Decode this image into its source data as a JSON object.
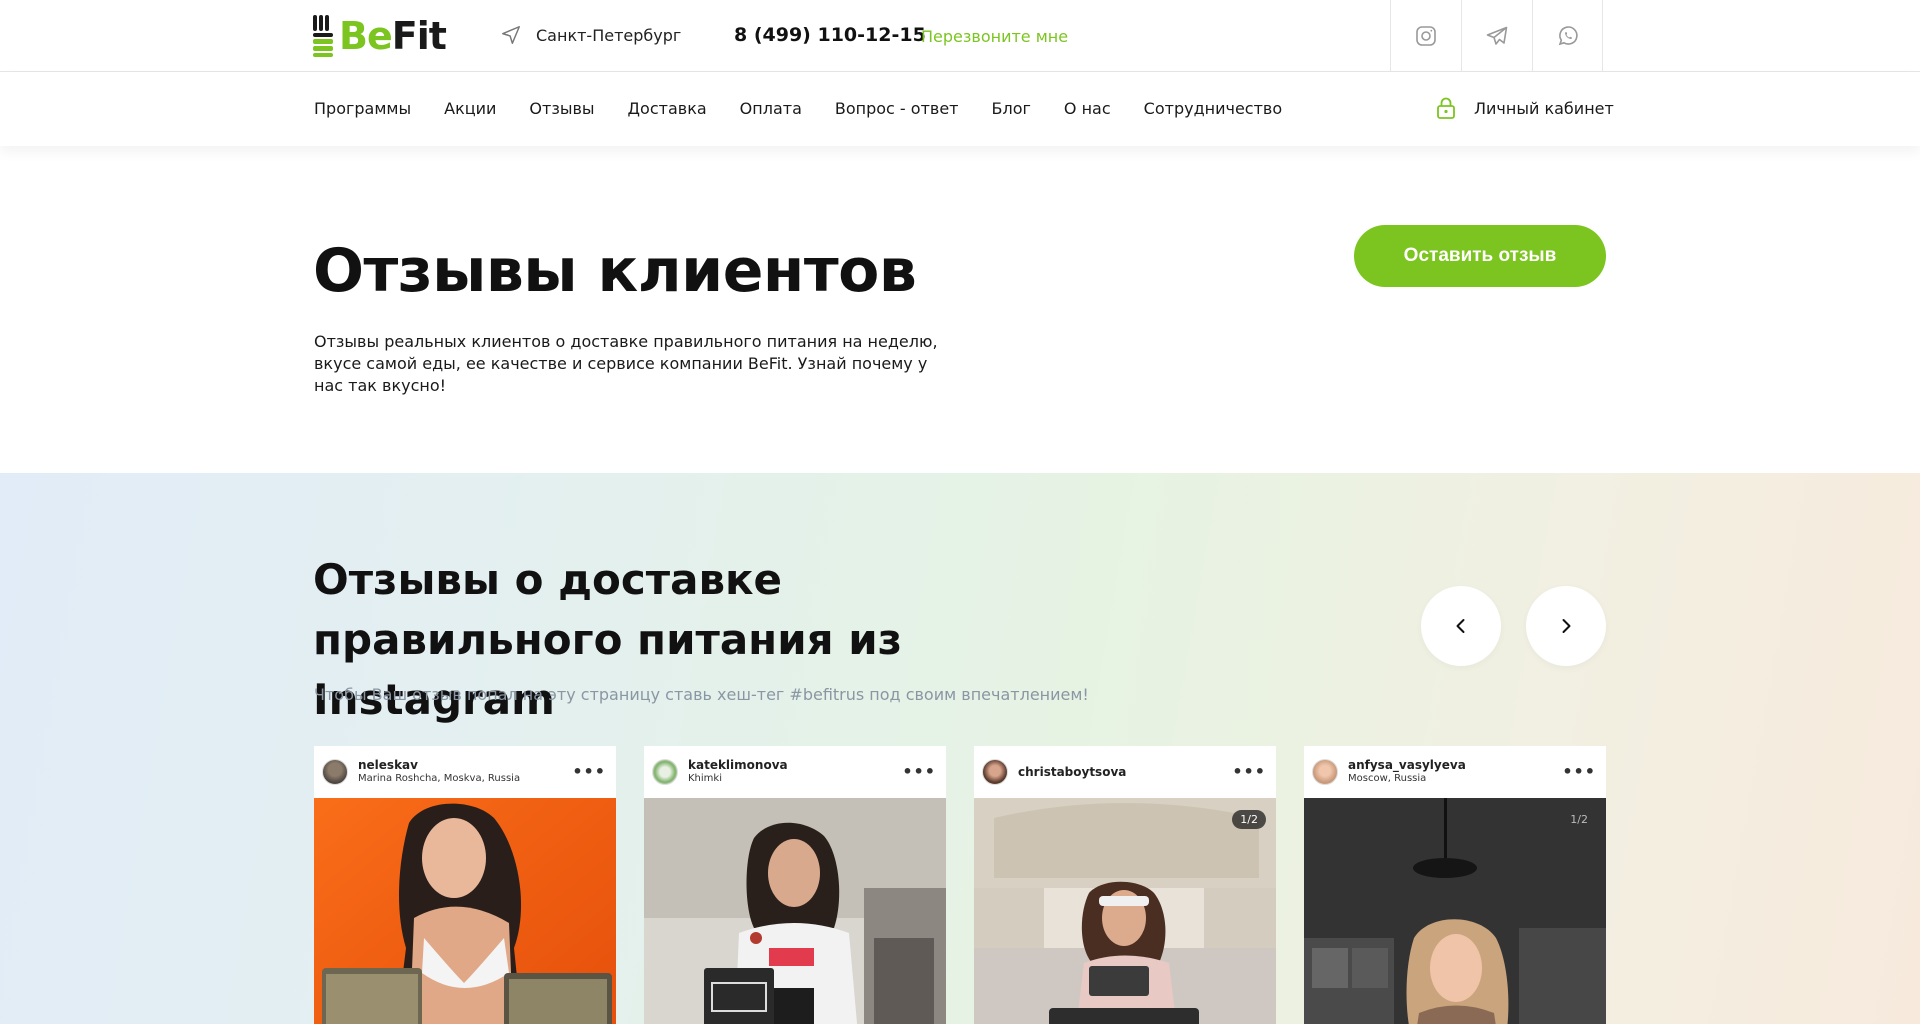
{
  "header": {
    "logo": {
      "part1": "Be",
      "part2": "Fit"
    },
    "city": "Санкт-Петербург",
    "phone": "8 (499) 110-12-15",
    "callback": "Перезвоните мне",
    "socials": [
      "instagram-icon",
      "telegram-icon",
      "whatsapp-icon"
    ]
  },
  "nav": {
    "items": [
      "Программы",
      "Акции",
      "Отзывы",
      "Доставка",
      "Оплата",
      "Вопрос - ответ",
      "Блог",
      "О нас",
      "Сотрудничество"
    ],
    "cabinet": "Личный кабинет"
  },
  "hero": {
    "title": "Отзывы клиентов",
    "description": "Отзывы реальных клиентов о доставке правильного питания на неделю, вкусе самой еды, ее качестве и сервисе компании BeFit. Узнай почему у нас так вкусно!",
    "button": "Оставить отзыв"
  },
  "instagram": {
    "title": "Отзывы о доставке правильного питания из Instagram",
    "subtitle": "Чтобы Ваш отзыв попал на эту страницу ставь хеш-тег #befitrus под своим впечатлением!",
    "posts": [
      {
        "username": "neleskav",
        "location": "Marina Roshcha, Moskva, Russia",
        "counter": ""
      },
      {
        "username": "kateklimonova",
        "location": "Khimki",
        "counter": ""
      },
      {
        "username": "christaboytsova",
        "location": "",
        "counter": "1/2"
      },
      {
        "username": "anfysa_vasylyeva",
        "location": "Moscow, Russia",
        "counter": "1/2"
      }
    ]
  },
  "colors": {
    "accent": "#7cc520",
    "text": "#1a1a1a",
    "muted": "#8a96a3"
  }
}
